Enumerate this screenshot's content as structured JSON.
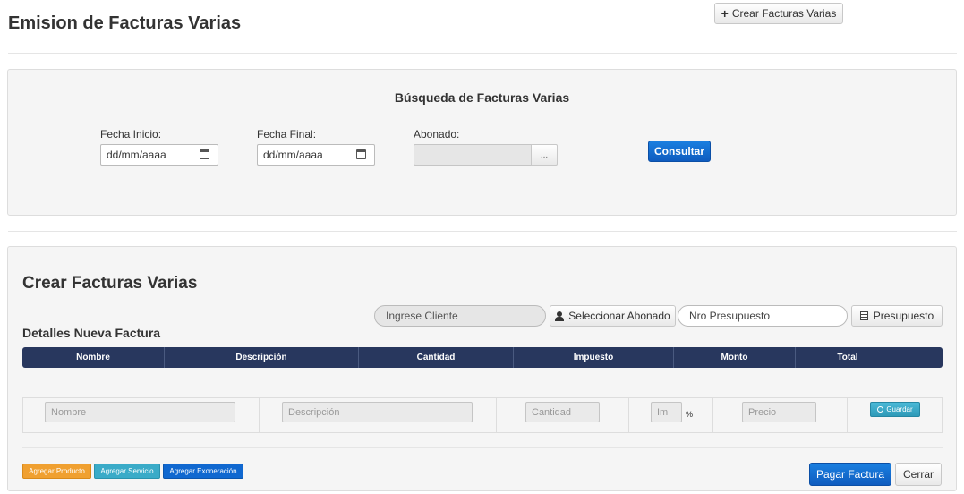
{
  "page": {
    "title": "Emision de Facturas Varias",
    "create_button": "Crear Facturas Varias"
  },
  "search": {
    "title": "Búsqueda de Facturas Varias",
    "fecha_inicio_label": "Fecha Inicio:",
    "fecha_inicio_value": "dd/mm/aaaa",
    "fecha_final_label": "Fecha Final:",
    "fecha_final_value": "dd/mm/aaaa",
    "abonado_label": "Abonado:",
    "abonado_value": "",
    "abonado_browse": "...",
    "consultar_button": "Consultar"
  },
  "create": {
    "title": "Crear Facturas Varias",
    "subtitle": "Detalles Nueva Factura",
    "cliente_placeholder": "Ingrese Cliente",
    "seleccionar_button": "Seleccionar Abonado",
    "presupuesto_placeholder": "Nro Presupuesto",
    "presupuesto_button": "Presupuesto",
    "columns": [
      "Nombre",
      "Descripción",
      "Cantidad",
      "Impuesto",
      "Monto",
      "Total",
      ""
    ],
    "row": {
      "nombre_placeholder": "Nombre",
      "descripcion_placeholder": "Descripción",
      "cantidad_placeholder": "Cantidad",
      "impuesto_placeholder": "Im",
      "impuesto_unit": "%",
      "precio_placeholder": "Precio",
      "guardar_button": "Guardar"
    },
    "agregar_producto": "Agregar Producto",
    "agregar_servicio": "Agregar Servicio",
    "agregar_exoneracion": "Agregar Exoneración",
    "pagar_button": "Pagar Factura",
    "cerrar_button": "Cerrar"
  },
  "colors": {
    "primary": "#1068d0",
    "table_header": "#28375e",
    "orange": "#f0a030",
    "info": "#3aabc8"
  }
}
